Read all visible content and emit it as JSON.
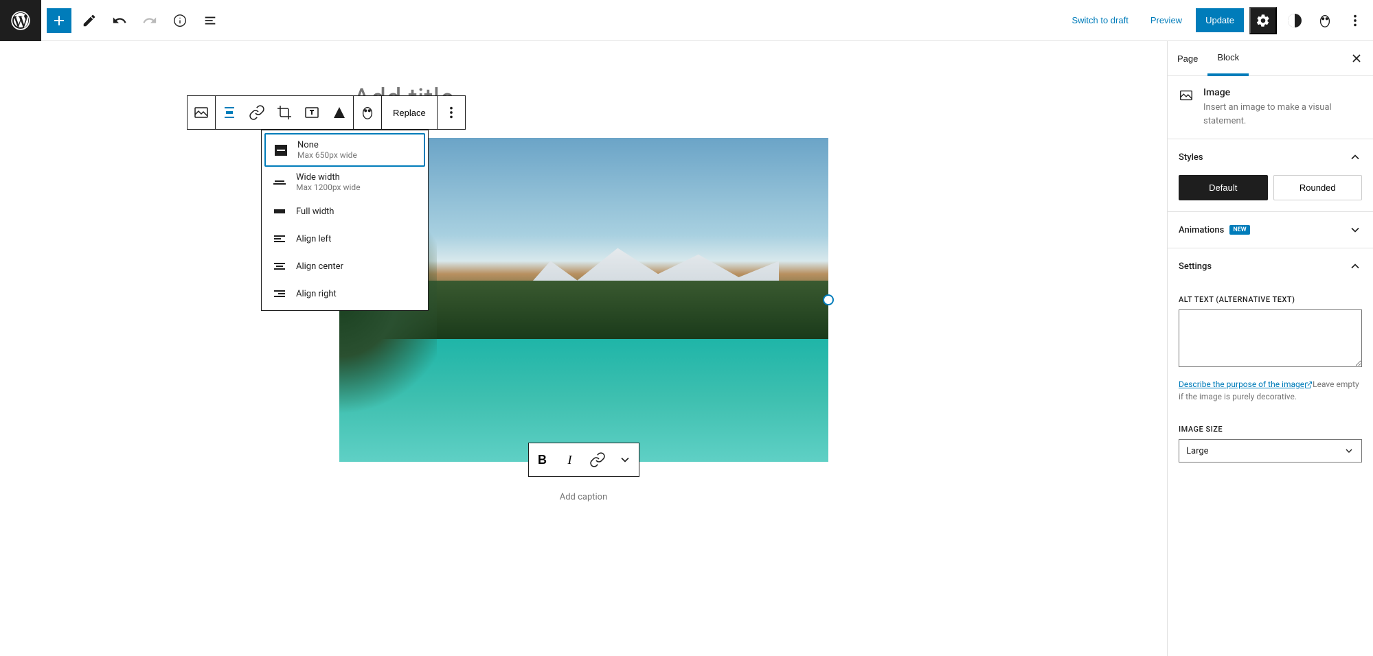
{
  "topbar": {
    "switch_to_draft": "Switch to draft",
    "preview": "Preview",
    "update": "Update"
  },
  "editor": {
    "title_placeholder": "Add title",
    "caption_placeholder": "Add caption"
  },
  "block_toolbar": {
    "replace": "Replace"
  },
  "align_dropdown": {
    "items": [
      {
        "label": "None",
        "sub": "Max 650px wide"
      },
      {
        "label": "Wide width",
        "sub": "Max 1200px wide"
      },
      {
        "label": "Full width",
        "sub": ""
      },
      {
        "label": "Align left",
        "sub": ""
      },
      {
        "label": "Align center",
        "sub": ""
      },
      {
        "label": "Align right",
        "sub": ""
      }
    ]
  },
  "sidebar": {
    "tabs": {
      "page": "Page",
      "block": "Block"
    },
    "block_type": {
      "title": "Image",
      "description": "Insert an image to make a visual statement."
    },
    "styles": {
      "title": "Styles",
      "default": "Default",
      "rounded": "Rounded"
    },
    "animations": {
      "title": "Animations",
      "badge": "NEW"
    },
    "settings": {
      "title": "Settings",
      "alt_label": "ALT TEXT (ALTERNATIVE TEXT)",
      "alt_value": "",
      "alt_help_link": "Describe the purpose of the image",
      "alt_help_trail": "Leave empty if the image is purely decorative.",
      "image_size_label": "IMAGE SIZE",
      "image_size_value": "Large"
    }
  }
}
